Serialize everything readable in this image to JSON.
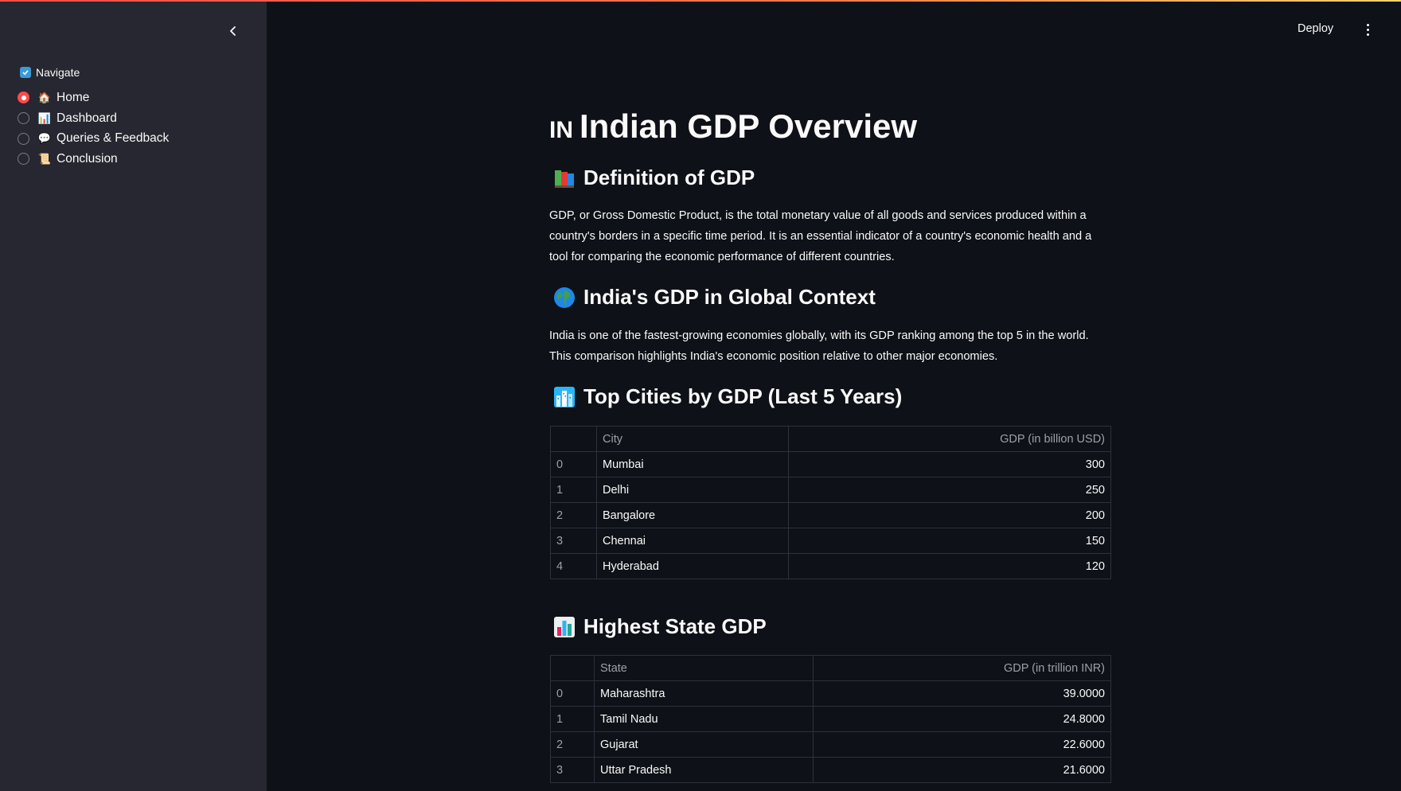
{
  "sidebar": {
    "collapse_icon": "chevron-left-icon",
    "nav_label": "Navigate",
    "items": [
      {
        "label": "Home",
        "emoji": "🏠",
        "selected": true
      },
      {
        "label": "Dashboard",
        "emoji": "📊",
        "selected": false
      },
      {
        "label": "Queries & Feedback",
        "emoji": "💬",
        "selected": false
      },
      {
        "label": "Conclusion",
        "emoji": "📜",
        "selected": false
      }
    ]
  },
  "header": {
    "deploy_label": "Deploy",
    "menu_icon": "kebab-menu-icon"
  },
  "main": {
    "title_flag": "IN",
    "title": "Indian GDP Overview",
    "sections": {
      "definition": {
        "icon": "books-icon",
        "heading": "Definition of GDP",
        "text": "GDP, or Gross Domestic Product, is the total monetary value of all goods and services produced within a country's borders in a specific time period. It is an essential indicator of a country's economic health and a tool for comparing the economic performance of different countries."
      },
      "global": {
        "icon": "globe-icon",
        "heading": "India's GDP in Global Context",
        "text": "India is one of the fastest-growing economies globally, with its GDP ranking among the top 5 in the world. This comparison highlights India's economic position relative to other major economies."
      },
      "cities": {
        "icon": "cityscape-icon",
        "heading": "Top Cities by GDP (Last 5 Years)",
        "columns": [
          "",
          "City",
          "GDP (in billion USD)"
        ],
        "rows": [
          [
            "0",
            "Mumbai",
            "300"
          ],
          [
            "1",
            "Delhi",
            "250"
          ],
          [
            "2",
            "Bangalore",
            "200"
          ],
          [
            "3",
            "Chennai",
            "150"
          ],
          [
            "4",
            "Hyderabad",
            "120"
          ]
        ]
      },
      "states": {
        "icon": "bar-chart-icon",
        "heading": "Highest State GDP",
        "columns": [
          "",
          "State",
          "GDP (in trillion INR)"
        ],
        "rows": [
          [
            "0",
            "Maharashtra",
            "39.0000"
          ],
          [
            "1",
            "Tamil Nadu",
            "24.8000"
          ],
          [
            "2",
            "Gujarat",
            "22.6000"
          ],
          [
            "3",
            "Uttar Pradesh",
            "21.6000"
          ]
        ]
      }
    }
  },
  "colors": {
    "background": "#0e1117",
    "sidebar": "#262730",
    "accent": "#ff4b4b",
    "text": "#fafafa",
    "muted": "#9ca0aa"
  }
}
